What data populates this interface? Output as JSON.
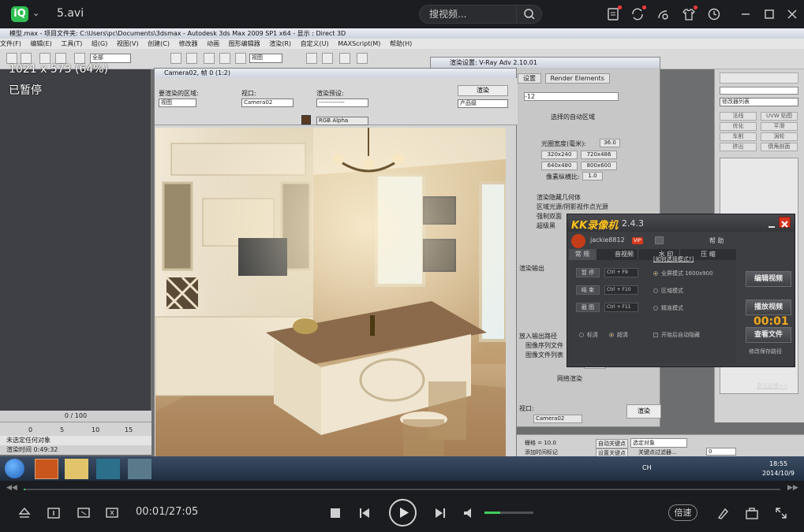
{
  "player": {
    "logo_glyph": "iQ",
    "file_title": "5.avi",
    "search_placeholder": "搜视频...",
    "overlay_resolution": "1021 x 573 (64%)",
    "overlay_status": "已暂停",
    "time_display": "00:01/27:05",
    "speed_label": "倍速",
    "progress_fraction": 0.0006,
    "volume_fraction": 0.33,
    "accent_color": "#3fce5c",
    "top_icons": [
      "upload-icon",
      "sync-icon",
      "share-icon",
      "skin-icon",
      "history-icon"
    ],
    "window_buttons": [
      "minimize-icon",
      "maximize-icon",
      "close-icon"
    ]
  },
  "max": {
    "title_bar": "模型.max    - 项目文件夹: C:\\Users\\pc\\Documents\\3dsmax    - Autodesk 3ds Max  2009 SP1  x64    - 显示 : Direct 3D",
    "menu": [
      "文件(F)",
      "编辑(E)",
      "工具(T)",
      "组(G)",
      "视图(V)",
      "创建(C)",
      "修改器",
      "动画",
      "图形编辑器",
      "渲染(R)",
      "自定义(U)",
      "MAXScript(M)",
      "帮助(H)"
    ],
    "toolbar_select": "全部",
    "toolbar_view": "视图",
    "timeline_label": "0 / 100",
    "ruler_ticks": [
      "0",
      "5",
      "10",
      "15"
    ],
    "status_line1": "未选定任何对象",
    "status_line2": "渲染时间  0:49:32",
    "cmd_dropdown": "修改器列表",
    "cmd_buttons": [
      "法线",
      "UVW 贴图",
      "优化",
      "平滑",
      "车削",
      "涡轮",
      "挤出",
      "倒角剖面"
    ]
  },
  "vray": {
    "title": "渲染设置: V-Ray Adv 2.10.01",
    "tabs": [
      "设置",
      "Render Elements"
    ],
    "field_value": "-12",
    "chk_auto_region": "选择的自动区域",
    "aperture_label": "光圈宽度(毫米):",
    "aperture_value": "36.0",
    "res_presets": [
      "320x240",
      "720x486",
      "640x480",
      "800x600"
    ],
    "pixel_aspect": "像素纵横比:",
    "pixel_aspect_value": "1.0",
    "chk_hidden_geo": "渲染隐藏几何体",
    "chk_area_lights": "区域光源/阴影视作点光源",
    "chk_force_2side": "强制双面",
    "chk_super_black": "超级黑",
    "label_render_output": "渲染输出",
    "chk_save_file": "图像序列文件",
    "chk_put_image_file": "图像文件列表",
    "label_save_path": "放入输出路径",
    "chk_net_render": "网络渲染",
    "view_label": "视口:",
    "view_value": "Camera02",
    "render_btn": "渲染",
    "settings_btn": "设置"
  },
  "frame": {
    "title": "Camera02, 帧 0 (1:2)",
    "area_label": "要渲染的区域:",
    "area_value": "视图",
    "viewport_label": "视口:",
    "viewport_value": "Camera02",
    "preset_label": "渲染预设:",
    "preset_value": "-------------",
    "render_btn": "渲染",
    "product_value": "产品级",
    "channel_value": "RGB Alpha"
  },
  "bottom_ctrl": {
    "frame_label": "栅格 = 10.0",
    "add_time_tag": "添加时间标记",
    "auto_key": "自动关键点",
    "set_key": "设置关键点",
    "selected_obj": "选定对象",
    "key_filter": "关键点过滤器...",
    "frame_value": "0"
  },
  "taskbar": {
    "clock_time": "18:55",
    "clock_date": "2014/10/9",
    "lang": "CH"
  },
  "kk": {
    "name": "KK录像机",
    "version": "2.4.3",
    "user": "jackie8812",
    "vip": "VIP",
    "help": "帮 助",
    "tabs": [
      "常 规",
      "音视频",
      "水 印",
      "压 缩"
    ],
    "link_mode": "[如何选择模式?]",
    "row_pause": "暂 停",
    "row_stop": "结 束",
    "row_shot": "截 图",
    "hot_pause": "Ctrl + F9",
    "hot_stop": "Ctrl + F10",
    "hot_shot": "Ctrl + F11",
    "mode_full": "全屏模式 1600x900",
    "mode_region": "区域模式",
    "mode_precise": "精准模式",
    "quality_hd": "标清",
    "quality_shd": "超清",
    "auto_hide": "开始后自动隐藏",
    "btn_edit": "编辑视频",
    "btn_play": "播放视频",
    "btn_view": "查看文件",
    "save_path": "修改保存路径",
    "timer": "00:01",
    "feedback": "意见反馈>>"
  }
}
